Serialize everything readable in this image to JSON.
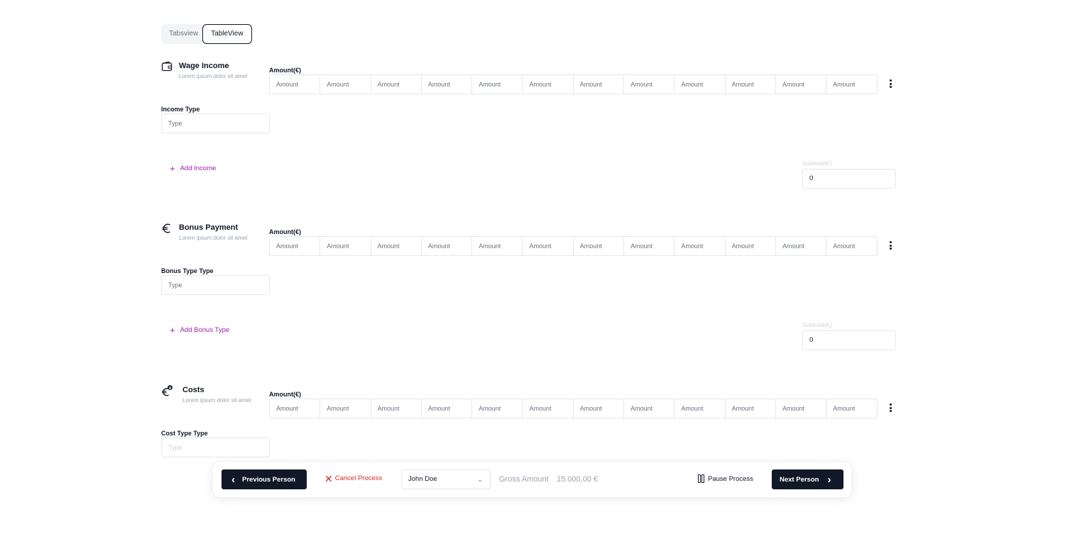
{
  "tabs": [
    {
      "label": "Tabsview",
      "active": false
    },
    {
      "label": "TableView",
      "active": true
    }
  ],
  "sections": [
    {
      "title": "Wage Income",
      "subtitle": "Lorem ipsum dolor sit amet",
      "icon": "wallet-icon",
      "amount_label": "Amount(€)",
      "amount_placeholder": "Amount",
      "type_label": "Income Type",
      "type_placeholder": "Type",
      "add_label": "Add Income",
      "subtotal_label": "Subtotal(€)",
      "subtotal_value": "0"
    },
    {
      "title": "Bonus Payment",
      "subtitle": "Lorem ipsum dolor sit amet",
      "icon": "euro-icon",
      "amount_label": "Amount(€)",
      "amount_placeholder": "Amount",
      "type_label": "Bonus Type Type",
      "type_placeholder": "Type",
      "add_label": "Add Bonus Type",
      "subtotal_label": "Subtotal(€)",
      "subtotal_value": "0"
    },
    {
      "title": "Costs",
      "subtitle": "Lorem ipsum dolor sit amet",
      "icon": "euro-down-icon",
      "amount_label": "Amount(€)",
      "amount_placeholder": "Amount",
      "type_label": "Cost Type Type",
      "type_placeholder": "Type"
    }
  ],
  "bottom_bar": {
    "previous_label": "Previous Person",
    "cancel_label": "Cancel Process",
    "person_selected": "John Doe",
    "gross_label": "Gross Amount",
    "gross_value": "15.000,00 €",
    "pause_label": "Pause Process",
    "next_label": "Next Person"
  },
  "colors": {
    "accent": "#a21caf",
    "primary_dark": "#111827",
    "danger": "#dc2626",
    "muted": "#9ca3af"
  }
}
